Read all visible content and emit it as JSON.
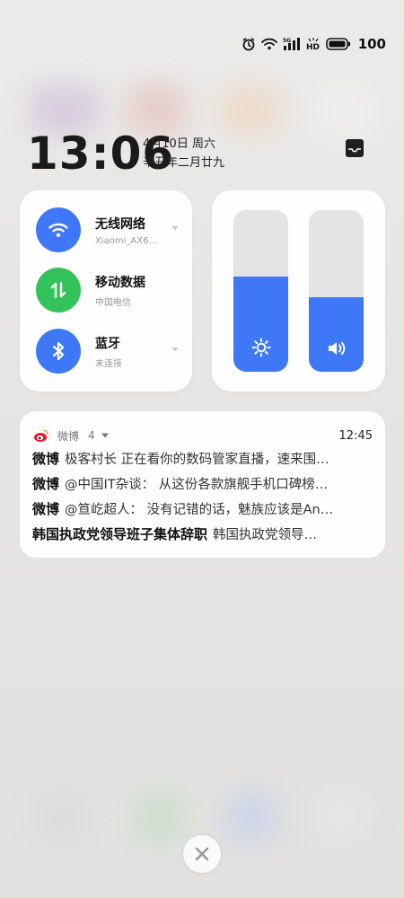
{
  "status_bar": {
    "battery_level": "100",
    "icons": [
      "alarm-icon",
      "wifi-icon",
      "signal-5g-icon",
      "hd-icon",
      "battery-icon"
    ]
  },
  "clock": {
    "time": "13:06",
    "date": "4月10日 周六",
    "lunar": "辛丑年二月廿九"
  },
  "connectivity": {
    "items": [
      {
        "title": "无线网络",
        "subtitle": "Xiaomi_AX6…",
        "color": "#3f78f6",
        "icon": "wifi-icon"
      },
      {
        "title": "移动数据",
        "subtitle": "中国电信",
        "color": "#34c25a",
        "icon": "mobile-data-icon"
      },
      {
        "title": "蓝牙",
        "subtitle": "未连接",
        "color": "#3f78f6",
        "icon": "bluetooth-icon"
      }
    ]
  },
  "sliders": {
    "brightness_level": 0.59,
    "volume_level": 0.46,
    "accent": "#3f78f6"
  },
  "notification": {
    "app_name": "微博",
    "count": "4",
    "time": "12:45",
    "messages": [
      {
        "sender": "微博",
        "text": "极客村长 正在看你的数码管家直播，速来围…"
      },
      {
        "sender": "微博",
        "text": "@中国IT杂谈： 从这份各款旗舰手机口碑榜…"
      },
      {
        "sender": "微博",
        "text": "@笪屹超人： 没有记错的话，魅族应该是An…"
      },
      {
        "sender": "韩国执政党领导班子集体辞职",
        "text": "韩国执政党领导…"
      }
    ]
  }
}
